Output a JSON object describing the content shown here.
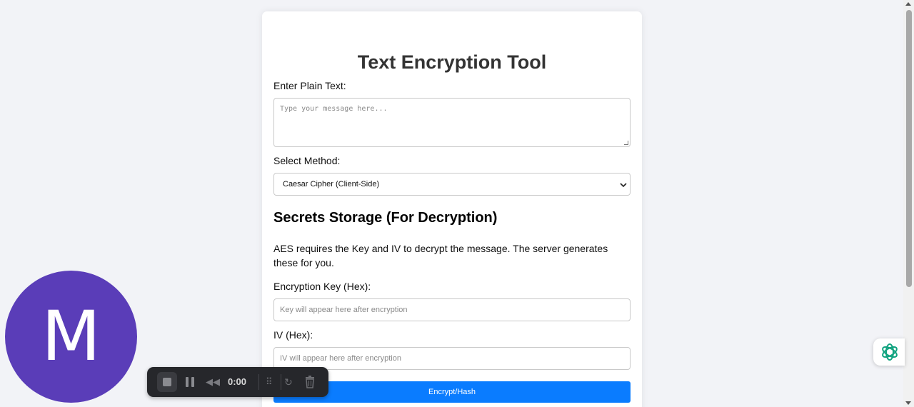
{
  "form": {
    "title": "Text Encryption Tool",
    "plain_text_label": "Enter Plain Text:",
    "plain_text_placeholder": "Type your message here...",
    "method_label": "Select Method:",
    "method_selected": "Caesar Cipher (Client-Side)",
    "secrets_heading": "Secrets Storage (For Decryption)",
    "secrets_description": "AES requires the Key and IV to decrypt the message. The server generates these for you.",
    "key_label": "Encryption Key (Hex):",
    "key_placeholder": "Key will appear here after encryption",
    "iv_label": "IV (Hex):",
    "iv_placeholder": "IV will appear here after encryption",
    "submit_label": "Encrypt/Hash"
  },
  "avatar": {
    "initial": "M",
    "color": "#5a3db8"
  },
  "recorder": {
    "time": "0:00"
  },
  "colors": {
    "primary_button": "#0a7cff",
    "background": "#f2f3f7",
    "floating_icon": "#10a37f"
  }
}
